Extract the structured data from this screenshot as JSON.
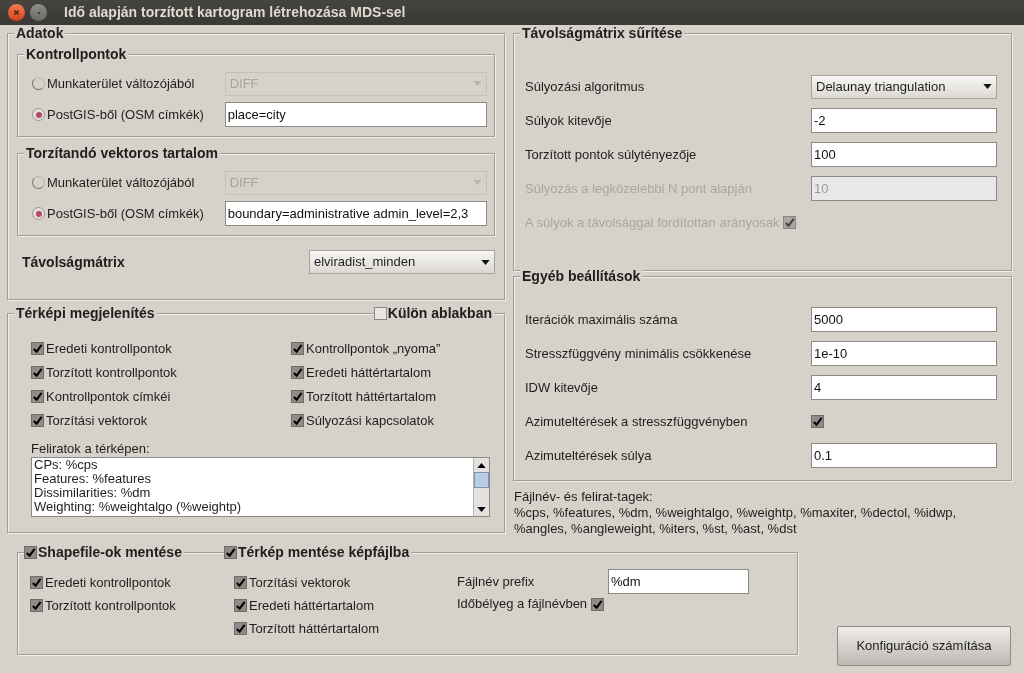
{
  "window": {
    "title": "Idő alapján torzított kartogram létrehozása MDS-sel"
  },
  "data_panel": {
    "title": "Adatok",
    "groups": [
      {
        "title": "Kontrollpontok",
        "options": [
          {
            "label": "Munkaterület változójából",
            "selected": false,
            "kind": "combo",
            "value": "DIFF",
            "disabled": true
          },
          {
            "label": "PostGIS-ből (OSM címkék)",
            "selected": true,
            "kind": "text",
            "value": "place=city",
            "disabled": false
          }
        ]
      },
      {
        "title": "Torzítandó vektoros tartalom",
        "options": [
          {
            "label": "Munkaterület változójából",
            "selected": false,
            "kind": "combo",
            "value": "DIFF",
            "disabled": true
          },
          {
            "label": "PostGIS-ből (OSM címkék)",
            "selected": true,
            "kind": "text",
            "value": "boundary=administrative admin_level=2,3",
            "disabled": false
          }
        ]
      }
    ],
    "matrix": {
      "label": "Távolságmátrix",
      "value": "elviradist_minden"
    }
  },
  "densify": {
    "title": "Távolságmátrix sűrítése",
    "rows": [
      {
        "kind": "combo",
        "label": "Súlyozási algoritmus",
        "value": "Delaunay triangulation",
        "disabled": false
      },
      {
        "kind": "text",
        "label": "Súlyok kitevője",
        "value": "-2",
        "disabled": false
      },
      {
        "kind": "text",
        "label": "Torzított pontok súlytényezője",
        "value": "100",
        "disabled": false
      },
      {
        "kind": "text",
        "label": "Súlyozás a legközelebbi N pont alapján",
        "value": "10",
        "disabled": true
      },
      {
        "kind": "checkbox",
        "label": "A súlyok a távolsággal fordítottan arányosak",
        "checked": true,
        "disabled": true
      }
    ]
  },
  "other": {
    "title": "Egyéb beállítások",
    "rows": [
      {
        "kind": "text",
        "label": "Iterációk maximális száma",
        "value": "5000",
        "disabled": false
      },
      {
        "kind": "text",
        "label": "Stresszfüggvény minimális csökkenése",
        "value": "1e-10",
        "disabled": false
      },
      {
        "kind": "text",
        "label": "IDW kitevője",
        "value": "4",
        "disabled": false
      },
      {
        "kind": "checkbox",
        "label": "Azimuteltérések a stresszfüggvényben",
        "checked": true,
        "disabled": false
      },
      {
        "kind": "text",
        "label": "Azimuteltérések súlya",
        "value": "0.1",
        "disabled": false
      }
    ]
  },
  "tags": {
    "label": "Fájlnév- és felirat-tagek:",
    "lines": [
      "%cps, %features, %dm, %weightalgo, %weightp, %maxiter, %dectol, %idwp,",
      "%angles, %angleweight, %iters, %st, %ast, %dst"
    ]
  },
  "map_display": {
    "title": "Térképi megjelenítés",
    "separate_window": {
      "label": "Külön ablakban",
      "checked": false
    },
    "checks": [
      {
        "label": "Eredeti kontrollpontok",
        "checked": true
      },
      {
        "label": "Kontrollpontok „nyoma”",
        "checked": true
      },
      {
        "label": "Torzított kontrollpontok",
        "checked": true
      },
      {
        "label": "Eredeti háttértartalom",
        "checked": true
      },
      {
        "label": "Kontrollpontok címkéi",
        "checked": true
      },
      {
        "label": "Torzított háttértartalom",
        "checked": true
      },
      {
        "label": "Torzítási vektorok",
        "checked": true
      },
      {
        "label": "Súlyozási kapcsolatok",
        "checked": true
      }
    ],
    "labels_title": "Feliratok a térképen:",
    "labels_lines": [
      "CPs: %cps",
      "Features: %features",
      "Dissimilarities: %dm",
      "Weighting: %weightalgo (%weightp)"
    ]
  },
  "save_shapefiles": {
    "label": "Shapefile-ok mentése",
    "checked": true,
    "items": [
      {
        "label": "Eredeti kontrollpontok",
        "checked": true
      },
      {
        "label": "Torzított kontrollpontok",
        "checked": true
      }
    ]
  },
  "save_image": {
    "label": "Térkép mentése képfájlba",
    "checked": true,
    "items": [
      {
        "label": "Torzítási vektorok",
        "checked": true
      },
      {
        "label": "Eredeti háttértartalom",
        "checked": true
      },
      {
        "label": "Torzított háttértartalom",
        "checked": true
      }
    ]
  },
  "file_options": {
    "prefix_label": "Fájlnév prefix",
    "prefix": "%dm",
    "timestamp_label": "Időbélyeg a fájlnévben",
    "timestamp": true
  },
  "compute_button": "Konfiguráció számítása"
}
